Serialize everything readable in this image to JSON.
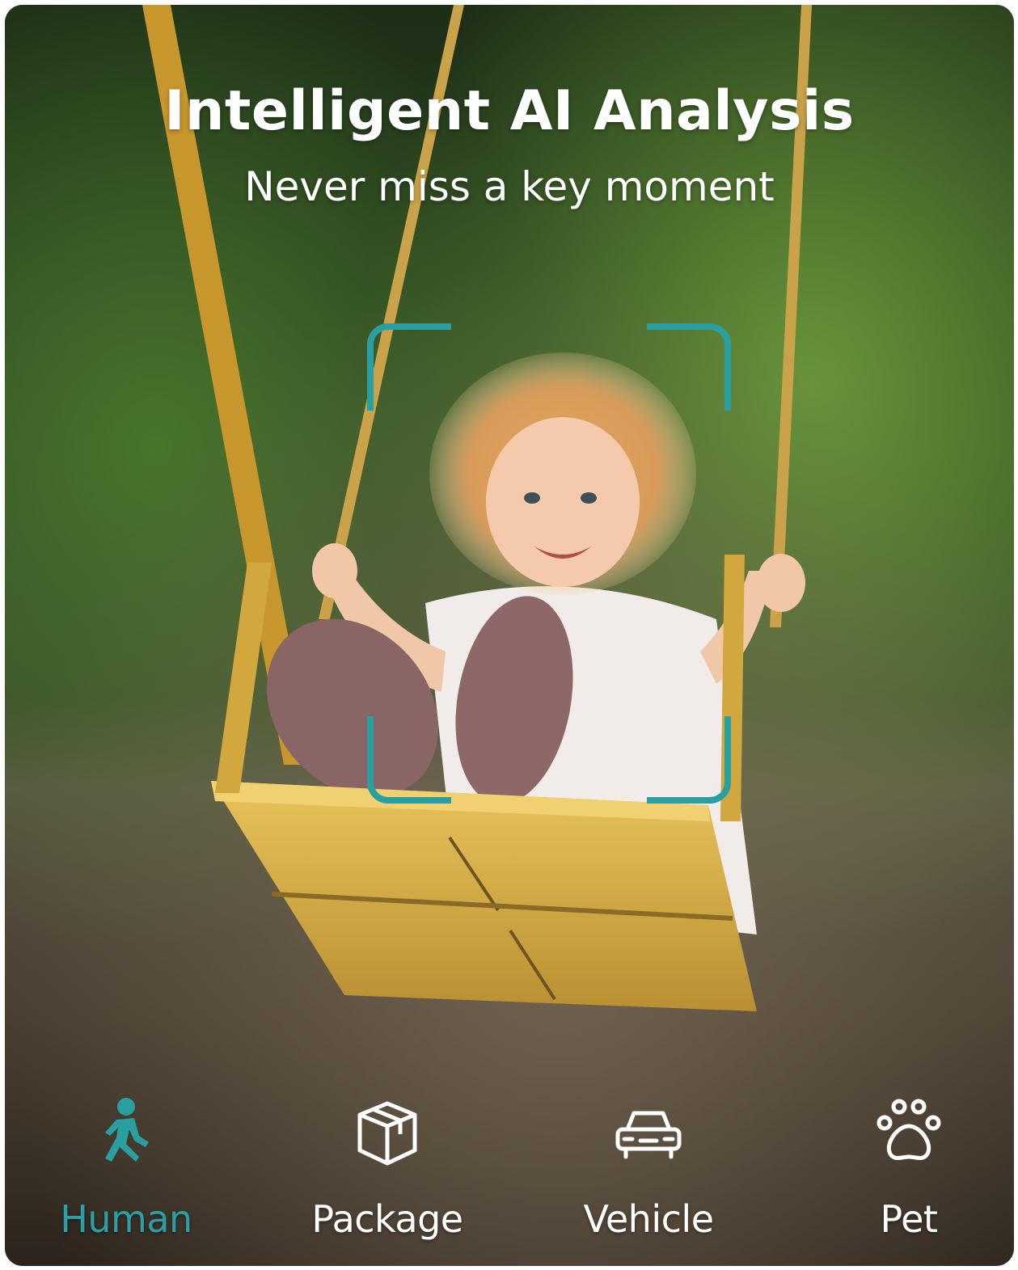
{
  "header": {
    "title": "Intelligent AI Analysis",
    "subtitle": "Never miss a key moment"
  },
  "photo": {
    "subject": "child-on-swing"
  },
  "focus_box": {
    "color": "#2a9fa2"
  },
  "detection_types": [
    {
      "label": "Human",
      "icon": "person-walking-icon",
      "active": true
    },
    {
      "label": "Package",
      "icon": "package-box-icon",
      "active": false
    },
    {
      "label": "Vehicle",
      "icon": "car-icon",
      "active": false
    },
    {
      "label": "Pet",
      "icon": "paw-icon",
      "active": false
    }
  ],
  "colors": {
    "accent": "#2a9fa2",
    "text": "#ffffff"
  }
}
